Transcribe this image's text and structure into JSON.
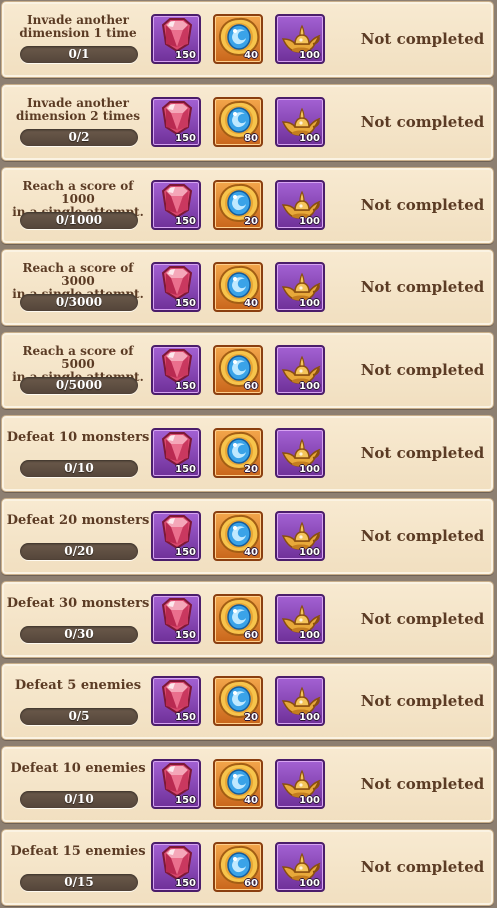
{
  "achievements": [
    {
      "title": "Invade another\ndimension 1 time",
      "progress_text": "0/1",
      "progress": 0,
      "rewards": [
        {
          "item": "gem",
          "count": "150"
        },
        {
          "item": "orb",
          "count": "40"
        },
        {
          "item": "lamp",
          "count": "100"
        }
      ],
      "status": "Not completed"
    },
    {
      "title": "Invade another\ndimension 2 times",
      "progress_text": "0/2",
      "progress": 0,
      "rewards": [
        {
          "item": "gem",
          "count": "150"
        },
        {
          "item": "orb",
          "count": "80"
        },
        {
          "item": "lamp",
          "count": "100"
        }
      ],
      "status": "Not completed"
    },
    {
      "title": "Reach a score of 1000\nin a single attempt.",
      "progress_text": "0/1000",
      "progress": 0,
      "rewards": [
        {
          "item": "gem",
          "count": "150"
        },
        {
          "item": "orb",
          "count": "20"
        },
        {
          "item": "lamp",
          "count": "100"
        }
      ],
      "status": "Not completed"
    },
    {
      "title": "Reach a score of 3000\nin a single attempt.",
      "progress_text": "0/3000",
      "progress": 0,
      "rewards": [
        {
          "item": "gem",
          "count": "150"
        },
        {
          "item": "orb",
          "count": "40"
        },
        {
          "item": "lamp",
          "count": "100"
        }
      ],
      "status": "Not completed"
    },
    {
      "title": "Reach a score of 5000\nin a single attempt.",
      "progress_text": "0/5000",
      "progress": 0,
      "rewards": [
        {
          "item": "gem",
          "count": "150"
        },
        {
          "item": "orb",
          "count": "60"
        },
        {
          "item": "lamp",
          "count": "100"
        }
      ],
      "status": "Not completed"
    },
    {
      "title": "Defeat 10 monsters",
      "progress_text": "0/10",
      "progress": 0,
      "rewards": [
        {
          "item": "gem",
          "count": "150"
        },
        {
          "item": "orb",
          "count": "20"
        },
        {
          "item": "lamp",
          "count": "100"
        }
      ],
      "status": "Not completed"
    },
    {
      "title": "Defeat 20 monsters",
      "progress_text": "0/20",
      "progress": 0,
      "rewards": [
        {
          "item": "gem",
          "count": "150"
        },
        {
          "item": "orb",
          "count": "40"
        },
        {
          "item": "lamp",
          "count": "100"
        }
      ],
      "status": "Not completed"
    },
    {
      "title": "Defeat 30 monsters",
      "progress_text": "0/30",
      "progress": 0,
      "rewards": [
        {
          "item": "gem",
          "count": "150"
        },
        {
          "item": "orb",
          "count": "60"
        },
        {
          "item": "lamp",
          "count": "100"
        }
      ],
      "status": "Not completed"
    },
    {
      "title": "Defeat 5 enemies",
      "progress_text": "0/5",
      "progress": 0,
      "rewards": [
        {
          "item": "gem",
          "count": "150"
        },
        {
          "item": "orb",
          "count": "20"
        },
        {
          "item": "lamp",
          "count": "100"
        }
      ],
      "status": "Not completed"
    },
    {
      "title": "Defeat 10 enemies",
      "progress_text": "0/10",
      "progress": 0,
      "rewards": [
        {
          "item": "gem",
          "count": "150"
        },
        {
          "item": "orb",
          "count": "40"
        },
        {
          "item": "lamp",
          "count": "100"
        }
      ],
      "status": "Not completed"
    },
    {
      "title": "Defeat 15 enemies",
      "progress_text": "0/15",
      "progress": 0,
      "rewards": [
        {
          "item": "gem",
          "count": "150"
        },
        {
          "item": "orb",
          "count": "60"
        },
        {
          "item": "lamp",
          "count": "100"
        }
      ],
      "status": "Not completed"
    }
  ]
}
